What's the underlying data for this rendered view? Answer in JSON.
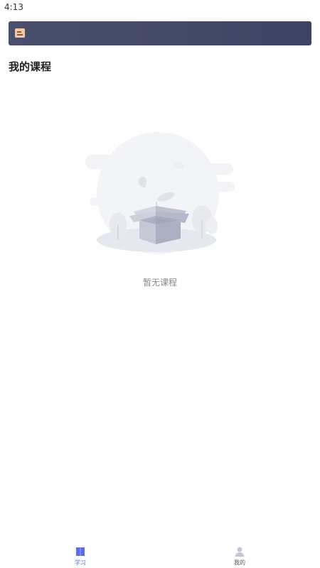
{
  "status_bar": {
    "time": "4:13"
  },
  "header": {
    "icon": "notebook-icon",
    "background_color": "#454a68"
  },
  "section": {
    "title": "我的课程"
  },
  "empty_state": {
    "icon": "empty-box-illustration",
    "message": "暂无课程"
  },
  "tab_bar": {
    "tabs": [
      {
        "label": "学习",
        "icon": "book-icon",
        "active": true,
        "color": "#5b6cf0"
      },
      {
        "label": "我的",
        "icon": "person-icon",
        "active": false,
        "color": "#555555"
      }
    ]
  }
}
